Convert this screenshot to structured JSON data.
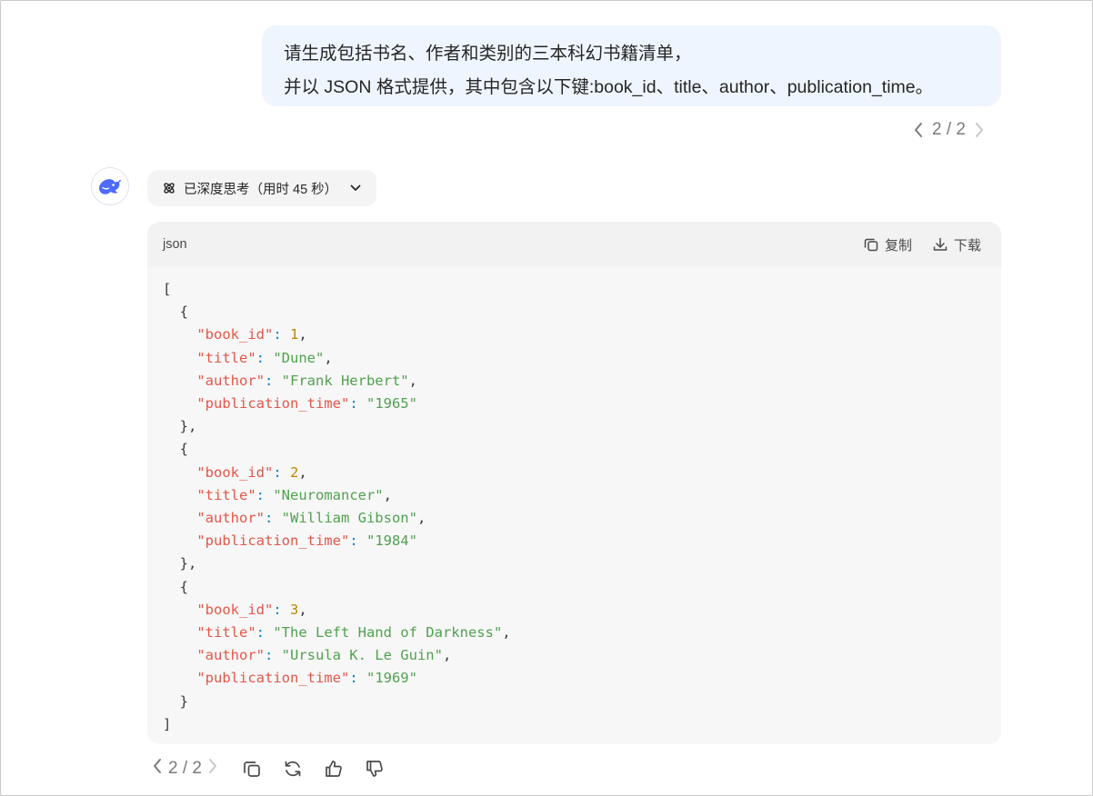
{
  "user_message": {
    "line1": "请生成包括书名、作者和类别的三本科幻书籍清单，",
    "line2": "并以 JSON 格式提供，其中包含以下键:book_id、title、author、publication_time。"
  },
  "user_pager": {
    "text": "2 / 2"
  },
  "assistant": {
    "avatar_icon": "whale-logo-icon",
    "thinking_label": "已深度思考（用时 45 秒）"
  },
  "code_block": {
    "language": "json",
    "copy_label": "复制",
    "download_label": "下载",
    "books": [
      {
        "book_id": 1,
        "title": "Dune",
        "author": "Frank Herbert",
        "publication_time": "1965"
      },
      {
        "book_id": 2,
        "title": "Neuromancer",
        "author": "William Gibson",
        "publication_time": "1984"
      },
      {
        "book_id": 3,
        "title": "The Left Hand of Darkness",
        "author": "Ursula K. Le Guin",
        "publication_time": "1969"
      }
    ]
  },
  "response_pager": {
    "text": "2 / 2"
  },
  "colors": {
    "user_bubble": "#eff5fe",
    "code_bg": "#f7f7f7",
    "json_key": "#e45649",
    "json_string": "#50a14f",
    "json_number": "#c18401"
  }
}
